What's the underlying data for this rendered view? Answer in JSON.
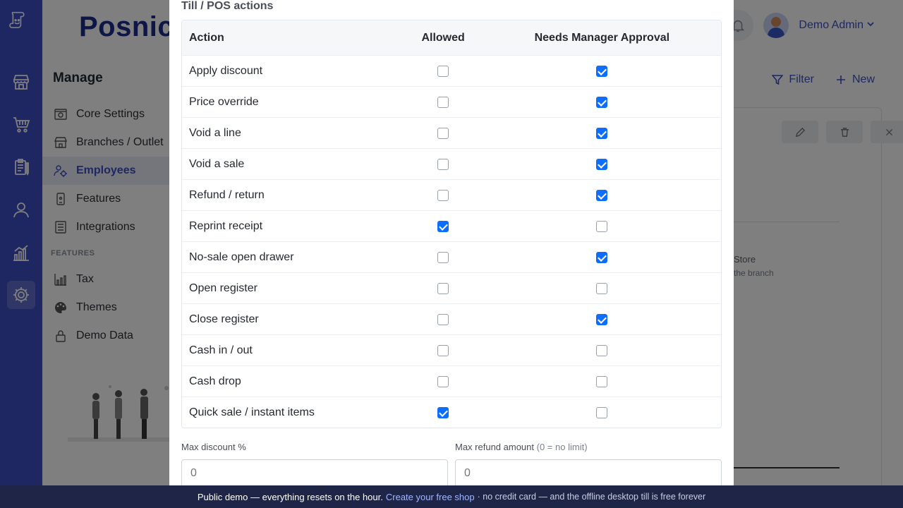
{
  "brand": "Posnic",
  "user": {
    "name": "Demo Admin"
  },
  "sidebar": {
    "heading": "Manage",
    "items": [
      {
        "label": "Core Settings",
        "icon": "settings-panel-icon"
      },
      {
        "label": "Branches / Outlet",
        "icon": "store-icon"
      },
      {
        "label": "Employees",
        "icon": "users-gear-icon",
        "active": true
      },
      {
        "label": "Features",
        "icon": "phone-icon"
      },
      {
        "label": "Integrations",
        "icon": "list-icon"
      }
    ],
    "section_features": "FEATURES",
    "feature_items": [
      {
        "label": "Tax",
        "icon": "chart-icon"
      },
      {
        "label": "Themes",
        "icon": "palette-icon"
      },
      {
        "label": "Demo Data",
        "icon": "lock-icon"
      }
    ]
  },
  "header_actions": {
    "filter": "Filter",
    "new": "New"
  },
  "panel": {
    "store": "Store",
    "branch": "the branch"
  },
  "modal": {
    "section_title": "Till / POS actions",
    "columns": {
      "action": "Action",
      "allowed": "Allowed",
      "manager": "Needs Manager Approval"
    },
    "rows": [
      {
        "action": "Apply discount",
        "allowed": false,
        "manager": true
      },
      {
        "action": "Price override",
        "allowed": false,
        "manager": true
      },
      {
        "action": "Void a line",
        "allowed": false,
        "manager": true
      },
      {
        "action": "Void a sale",
        "allowed": false,
        "manager": true
      },
      {
        "action": "Refund / return",
        "allowed": false,
        "manager": true
      },
      {
        "action": "Reprint receipt",
        "allowed": true,
        "manager": false
      },
      {
        "action": "No-sale open drawer",
        "allowed": false,
        "manager": true
      },
      {
        "action": "Open register",
        "allowed": false,
        "manager": false
      },
      {
        "action": "Close register",
        "allowed": false,
        "manager": true
      },
      {
        "action": "Cash in / out",
        "allowed": false,
        "manager": false
      },
      {
        "action": "Cash drop",
        "allowed": false,
        "manager": false
      },
      {
        "action": "Quick sale / instant items",
        "allowed": true,
        "manager": false
      }
    ],
    "max_discount": {
      "label": "Max discount %",
      "placeholder": "0"
    },
    "max_refund": {
      "label": "Max refund amount",
      "hint": "(0 = no limit)",
      "placeholder": "0"
    }
  },
  "banner": {
    "text": "Public demo — everything resets on the hour.",
    "link": "Create your free shop",
    "rest": "· no credit card — and the offline desktop till is free forever"
  },
  "colors": {
    "rail": "#3f4fc4",
    "accent": "#0d6efd",
    "banner": "#1f2547"
  }
}
